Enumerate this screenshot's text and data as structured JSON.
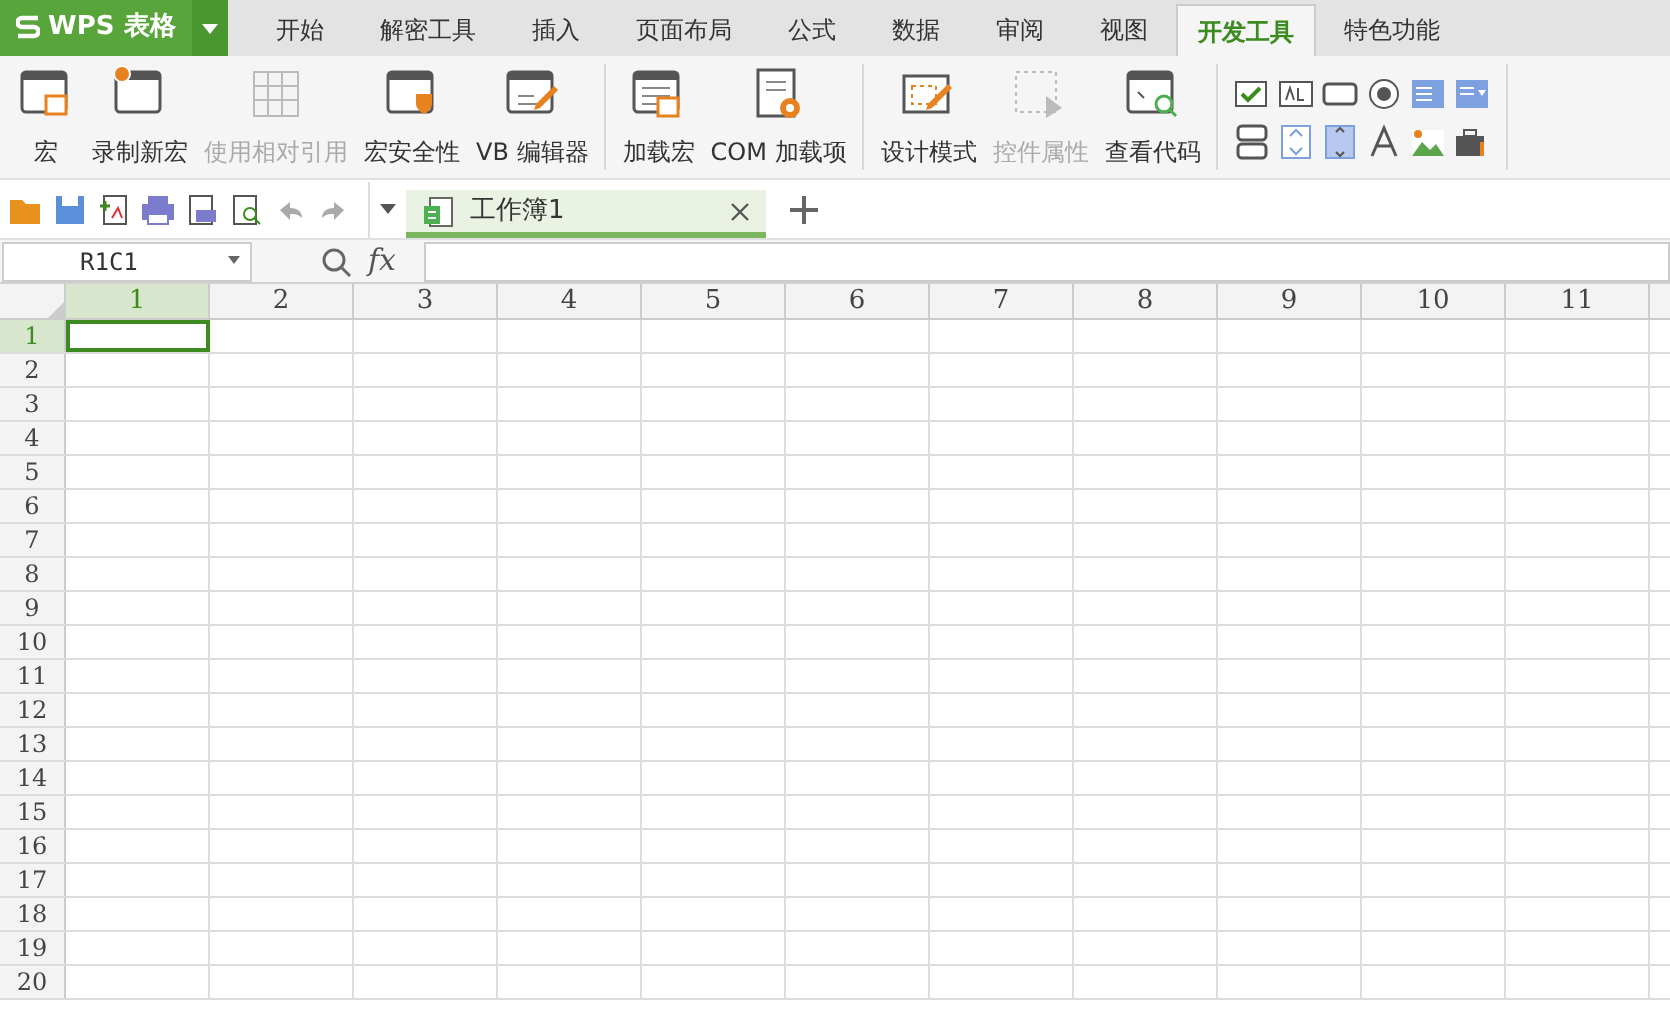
{
  "app_menu": {
    "label": "WPS 表格"
  },
  "tabs": [
    {
      "label": "开始",
      "selected": false
    },
    {
      "label": "解密工具",
      "selected": false
    },
    {
      "label": "插入",
      "selected": false
    },
    {
      "label": "页面布局",
      "selected": false
    },
    {
      "label": "公式",
      "selected": false
    },
    {
      "label": "数据",
      "selected": false
    },
    {
      "label": "审阅",
      "selected": false
    },
    {
      "label": "视图",
      "selected": false
    },
    {
      "label": "开发工具",
      "selected": true
    },
    {
      "label": "特色功能",
      "selected": false
    }
  ],
  "ribbon_groups": [
    {
      "items": [
        {
          "label": "宏",
          "disabled": false
        },
        {
          "label": "录制新宏",
          "disabled": false
        },
        {
          "label": "使用相对引用",
          "disabled": true
        },
        {
          "label": "宏安全性",
          "disabled": false
        },
        {
          "label": "VB 编辑器",
          "disabled": false
        }
      ]
    },
    {
      "items": [
        {
          "label": "加载宏",
          "disabled": false
        },
        {
          "label": "COM 加载项",
          "disabled": false
        }
      ]
    },
    {
      "items": [
        {
          "label": "设计模式",
          "disabled": false
        },
        {
          "label": "控件属性",
          "disabled": true
        },
        {
          "label": "查看代码",
          "disabled": false
        }
      ]
    }
  ],
  "document_tabs": [
    {
      "label": "工作簿1",
      "selected": true
    }
  ],
  "formula_bar": {
    "name_box": "R1C1",
    "fx": "fx"
  },
  "columns": [
    {
      "label": "1",
      "selected": true
    },
    {
      "label": "2",
      "selected": false
    },
    {
      "label": "3",
      "selected": false
    },
    {
      "label": "4",
      "selected": false
    },
    {
      "label": "5",
      "selected": false
    },
    {
      "label": "6",
      "selected": false
    },
    {
      "label": "7",
      "selected": false
    },
    {
      "label": "8",
      "selected": false
    },
    {
      "label": "9",
      "selected": false
    },
    {
      "label": "10",
      "selected": false
    },
    {
      "label": "11",
      "selected": false
    }
  ],
  "rows": [
    {
      "label": "1",
      "selected": true
    },
    {
      "label": "2",
      "selected": false
    },
    {
      "label": "3",
      "selected": false
    },
    {
      "label": "4",
      "selected": false
    },
    {
      "label": "5",
      "selected": false
    },
    {
      "label": "6",
      "selected": false
    },
    {
      "label": "7",
      "selected": false
    },
    {
      "label": "8",
      "selected": false
    },
    {
      "label": "9",
      "selected": false
    },
    {
      "label": "10",
      "selected": false
    },
    {
      "label": "11",
      "selected": false
    },
    {
      "label": "12",
      "selected": false
    },
    {
      "label": "13",
      "selected": false
    },
    {
      "label": "14",
      "selected": false
    },
    {
      "label": "15",
      "selected": false
    },
    {
      "label": "16",
      "selected": false
    },
    {
      "label": "17",
      "selected": false
    },
    {
      "label": "18",
      "selected": false
    },
    {
      "label": "19",
      "selected": false
    },
    {
      "label": "20",
      "selected": false
    }
  ]
}
